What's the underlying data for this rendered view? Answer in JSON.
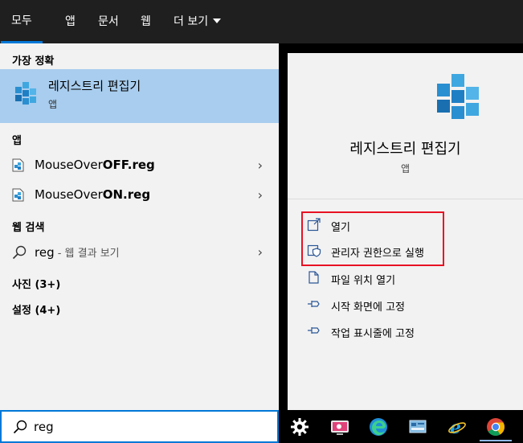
{
  "tabs": [
    {
      "label": "모두"
    },
    {
      "label": "앱"
    },
    {
      "label": "문서"
    },
    {
      "label": "웹"
    },
    {
      "label": "더 보기"
    }
  ],
  "left": {
    "best_match_header": "가장 정확",
    "best_match": {
      "title": "레지스트리 편집기",
      "subtitle": "앱"
    },
    "apps_header": "앱",
    "apps": [
      {
        "name": "MouseOver",
        "bold": "OFF.reg"
      },
      {
        "name": "MouseOver",
        "bold": "ON.reg"
      }
    ],
    "web_header": "웹 검색",
    "web": {
      "query": "reg",
      "suffix": " - 웹 결과 보기"
    },
    "photos": "사진 (3+)",
    "settings": "설정 (4+)"
  },
  "right": {
    "app_title": "레지스트리 편집기",
    "app_subtitle": "앱",
    "actions": [
      {
        "label": "열기",
        "icon": "open-icon"
      },
      {
        "label": "관리자 권한으로 실행",
        "icon": "run-as-admin-icon"
      },
      {
        "label": "파일 위치 열기",
        "icon": "file-location-icon"
      },
      {
        "label": "시작 화면에 고정",
        "icon": "pin-icon"
      },
      {
        "label": "작업 표시줄에 고정",
        "icon": "pin-icon"
      }
    ]
  },
  "search": {
    "value": "reg"
  },
  "taskbar": [
    "settings-gear-icon",
    "screen-recorder-icon",
    "edge-icon",
    "control-panel-icon",
    "internet-explorer-icon",
    "chrome-icon"
  ],
  "colors": {
    "accent": "#0078d7",
    "selection": "#a8cdee",
    "highlight_box": "#e81123"
  }
}
